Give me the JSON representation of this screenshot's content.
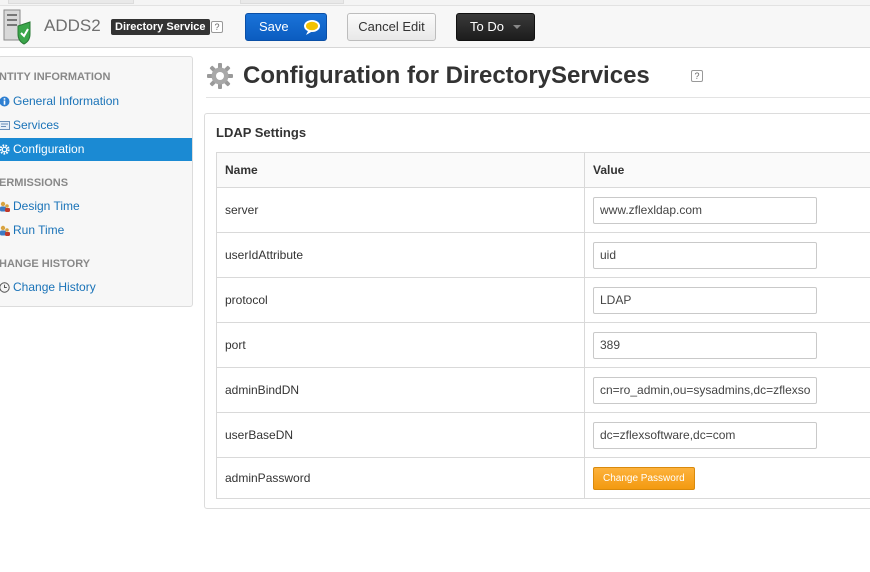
{
  "app": {
    "name": "ADDS2",
    "badge": "Directory Service",
    "help": "?"
  },
  "toolbar": {
    "save_label": "Save",
    "cancel_label": "Cancel Edit",
    "todo_label": "To Do"
  },
  "sidebar": {
    "sections": [
      {
        "title": "NTITY INFORMATION"
      },
      {
        "title": "ERMISSIONS"
      },
      {
        "title": "HANGE HISTORY"
      }
    ],
    "items": [
      {
        "label": "General Information",
        "icon": "info-icon"
      },
      {
        "label": "Services",
        "icon": "services-icon"
      },
      {
        "label": "Configuration",
        "icon": "gear-icon",
        "active": true
      },
      {
        "label": "Design Time",
        "icon": "users-icon"
      },
      {
        "label": "Run Time",
        "icon": "users-icon"
      },
      {
        "label": "Change History",
        "icon": "clock-icon"
      }
    ]
  },
  "page": {
    "title": "Configuration for DirectoryServices",
    "help": "?"
  },
  "panel": {
    "title": "LDAP Settings",
    "columns": [
      "Name",
      "Value"
    ],
    "rows": [
      {
        "name": "server",
        "value": "www.zflexldap.com"
      },
      {
        "name": "userIdAttribute",
        "value": "uid"
      },
      {
        "name": "protocol",
        "value": "LDAP"
      },
      {
        "name": "port",
        "value": "389"
      },
      {
        "name": "adminBindDN",
        "value": "cn=ro_admin,ou=sysadmins,dc=zflexsoftware,dc=com"
      },
      {
        "name": "userBaseDN",
        "value": "dc=zflexsoftware,dc=com"
      },
      {
        "name": "adminPassword",
        "button": "Change Password"
      }
    ]
  },
  "colors": {
    "accent": "#1b8ad3",
    "save": "#0b5cc0",
    "change_password": "#f39a10"
  }
}
